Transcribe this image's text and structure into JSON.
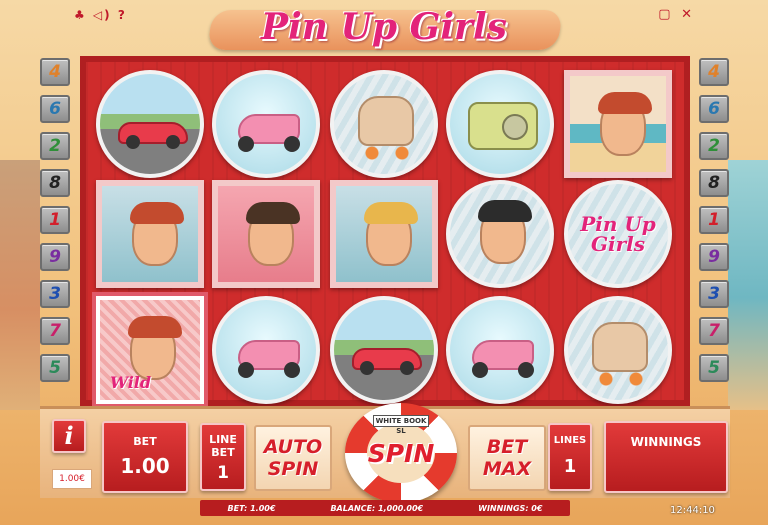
{
  "title": "Pin Up Girls",
  "top_left_icons": "♣ ◁) ?",
  "top_right_icons": {
    "minimize": "▢",
    "close": "✕"
  },
  "paylines": {
    "left": [
      {
        "n": "4",
        "color": "#e0812a"
      },
      {
        "n": "6",
        "color": "#2a78b0"
      },
      {
        "n": "2",
        "color": "#2f8f39"
      },
      {
        "n": "8",
        "color": "#222222"
      },
      {
        "n": "1",
        "color": "#d31f2b"
      },
      {
        "n": "9",
        "color": "#7a2ea0"
      },
      {
        "n": "3",
        "color": "#1e4fb0"
      },
      {
        "n": "7",
        "color": "#c8206a"
      },
      {
        "n": "5",
        "color": "#2c8a5a"
      }
    ],
    "right": [
      {
        "n": "4",
        "color": "#e0812a"
      },
      {
        "n": "6",
        "color": "#2a78b0"
      },
      {
        "n": "2",
        "color": "#2f8f39"
      },
      {
        "n": "8",
        "color": "#222222"
      },
      {
        "n": "1",
        "color": "#d31f2b"
      },
      {
        "n": "9",
        "color": "#7a2ea0"
      },
      {
        "n": "3",
        "color": "#1e4fb0"
      },
      {
        "n": "7",
        "color": "#c8206a"
      },
      {
        "n": "5",
        "color": "#2c8a5a"
      }
    ]
  },
  "reels": [
    [
      "car",
      "redhead-portrait",
      "wild-portrait"
    ],
    [
      "scooter",
      "brunette-portrait",
      "scooter"
    ],
    [
      "roller-skate",
      "blonde-portrait",
      "car"
    ],
    [
      "radio",
      "man-portrait",
      "scooter"
    ],
    [
      "swimsuit-portrait",
      "logo",
      "roller-skate"
    ]
  ],
  "logo_symbol": {
    "line1": "Pin Up",
    "line2": "Girls"
  },
  "wild_label": "Wild",
  "controls": {
    "info": "i",
    "coin_value": "1.00€",
    "bet_label": "BET",
    "bet_value": "1.00",
    "line_bet_label": "LINE BET",
    "line_bet_value": "1",
    "auto_spin": "AUTO SPIN",
    "spin_badge": "WHITE BOOK SL",
    "spin": "SPIN",
    "bet_max": "BET MAX",
    "lines_label": "LINES",
    "lines_value": "1",
    "winnings_label": "WINNINGS"
  },
  "status": {
    "bet": "BET: 1.00€",
    "balance": "BALANCE: 1,000.00€",
    "winnings": "WINNINGS: 0€"
  },
  "clock": "12:44:10"
}
